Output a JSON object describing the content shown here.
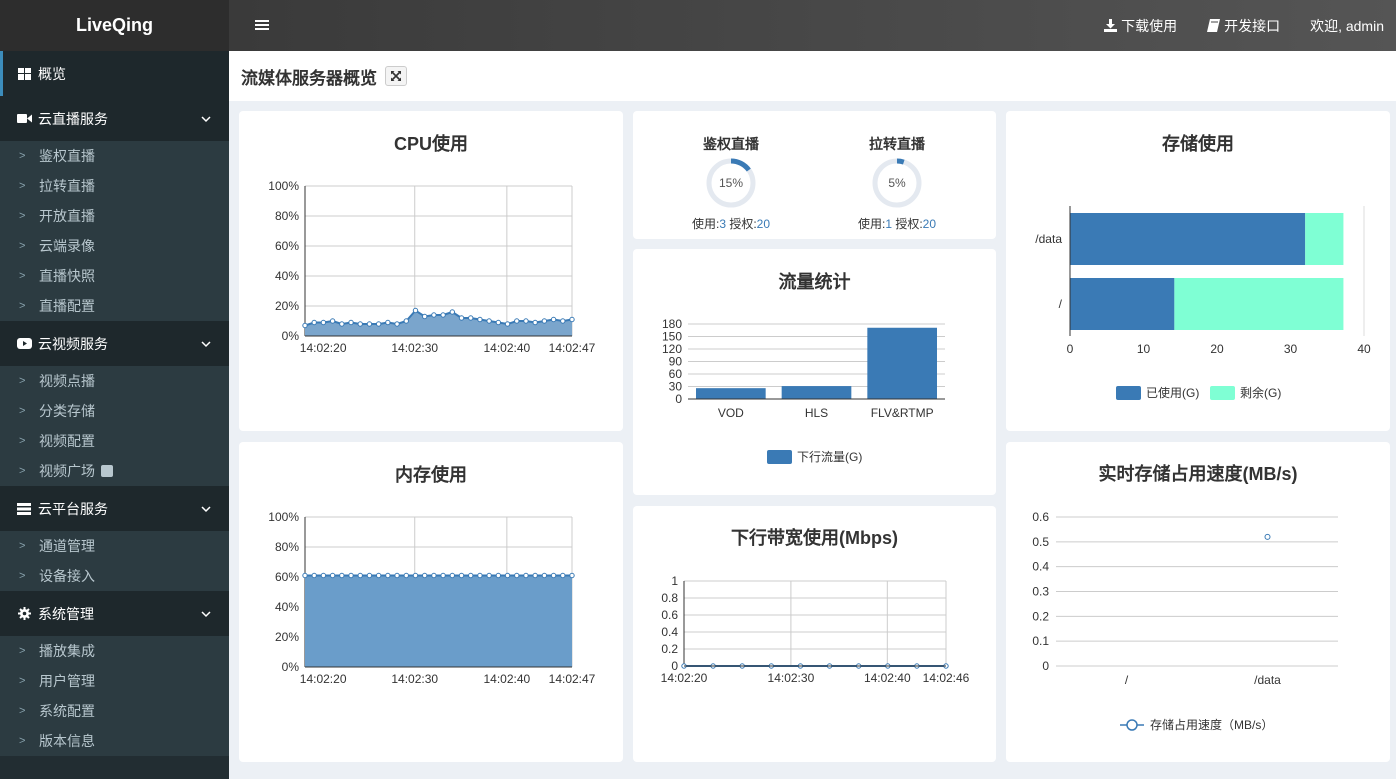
{
  "app": {
    "logo": "LiveQing"
  },
  "header": {
    "download": "下载使用",
    "dev_api": "开发接口",
    "welcome": "欢迎, admin"
  },
  "page": {
    "title": "流媒体服务器概览"
  },
  "sidebar": {
    "overview": "概览",
    "groups": [
      {
        "label": "云直播服务",
        "items": [
          "鉴权直播",
          "拉转直播",
          "开放直播",
          "云端录像",
          "直播快照",
          "直播配置"
        ]
      },
      {
        "label": "云视频服务",
        "items": [
          "视频点播",
          "分类存储",
          "视频配置",
          "视频广场"
        ]
      },
      {
        "label": "云平台服务",
        "items": [
          "通道管理",
          "设备接入"
        ]
      },
      {
        "label": "系统管理",
        "items": [
          "播放集成",
          "用户管理",
          "系统配置",
          "版本信息"
        ]
      }
    ]
  },
  "cpu": {
    "title": "CPU使用",
    "chart_data": {
      "type": "area",
      "title": "CPU使用",
      "x_ticks": [
        "14:02:20",
        "14:02:30",
        "14:02:40",
        "14:02:47"
      ],
      "y_ticks": [
        "100%",
        "80%",
        "60%",
        "40%",
        "20%",
        "0%"
      ],
      "ylim": [
        0,
        100
      ],
      "values": [
        7,
        9,
        9,
        10,
        8,
        9,
        8,
        8,
        8,
        9,
        8,
        10,
        17,
        13,
        14,
        14,
        16,
        12,
        12,
        11,
        10,
        9,
        8,
        10,
        10,
        9,
        10,
        11,
        10,
        11
      ],
      "grid": true,
      "color": "#3a7ab5"
    }
  },
  "memory": {
    "title": "内存使用",
    "chart_data": {
      "type": "area",
      "title": "内存使用",
      "x_ticks": [
        "14:02:20",
        "14:02:30",
        "14:02:40",
        "14:02:47"
      ],
      "y_ticks": [
        "100%",
        "80%",
        "60%",
        "40%",
        "20%",
        "0%"
      ],
      "ylim": [
        0,
        100
      ],
      "values": [
        61,
        61,
        61,
        61,
        61,
        61,
        61,
        61,
        61,
        61,
        61,
        61,
        61,
        61,
        61,
        61,
        61,
        61,
        61,
        61,
        61,
        61,
        61,
        61,
        61,
        61,
        61,
        61,
        61,
        61
      ],
      "grid": true,
      "color": "#3a7ab5"
    }
  },
  "gauges": [
    {
      "title": "鉴权直播",
      "percent": 15,
      "percent_label": "15%",
      "used_label": "使用:",
      "used": "3",
      "auth_label": "授权:",
      "auth": "20"
    },
    {
      "title": "拉转直播",
      "percent": 5,
      "percent_label": "5%",
      "used_label": "使用:",
      "used": "1",
      "auth_label": "授权:",
      "auth": "20"
    }
  ],
  "traffic": {
    "title": "流量统计",
    "chart_data": {
      "type": "bar",
      "title": "流量统计",
      "categories": [
        "VOD",
        "HLS",
        "FLV&RTMP"
      ],
      "series": [
        {
          "name": "下行流量(G)",
          "values": [
            26,
            31,
            171
          ]
        }
      ],
      "y_ticks": [
        "180",
        "150",
        "120",
        "90",
        "60",
        "30",
        "0"
      ],
      "ylim": [
        0,
        180
      ],
      "grid": true,
      "legend": "bottom",
      "color": "#3a7ab5"
    }
  },
  "bandwidth": {
    "title": "下行带宽使用(Mbps)",
    "chart_data": {
      "type": "line",
      "title": "下行带宽使用(Mbps)",
      "x_ticks": [
        "14:02:20",
        "14:02:30",
        "14:02:40",
        "14:02:46"
      ],
      "y_ticks": [
        "1",
        "0.8",
        "0.6",
        "0.4",
        "0.2",
        "0"
      ],
      "ylim": [
        0,
        1
      ],
      "values": [
        0,
        0,
        0,
        0,
        0,
        0,
        0,
        0,
        0,
        0
      ],
      "grid": true,
      "color": "#3a7ab5"
    }
  },
  "storage": {
    "title": "存储使用",
    "chart_data": {
      "type": "bar",
      "orientation": "horizontal",
      "stacked": true,
      "title": "存储使用",
      "categories": [
        "/data",
        "/"
      ],
      "series": [
        {
          "name": "已使用(G)",
          "values": [
            32,
            14.2
          ],
          "color": "#3a7ab5"
        },
        {
          "name": "剩余(G)",
          "values": [
            5.2,
            23
          ],
          "color": "#7fffd4"
        }
      ],
      "x_ticks": [
        "0",
        "10",
        "20",
        "30",
        "40"
      ],
      "xlim": [
        0,
        40
      ],
      "legend": "bottom"
    }
  },
  "speed": {
    "title": "实时存储占用速度(MB/s)",
    "chart_data": {
      "type": "scatter",
      "title": "实时存储占用速度(MB/s)",
      "categories": [
        "/",
        "/data"
      ],
      "series": [
        {
          "name": "存储占用速度（MB/s）",
          "values": [
            0,
            0.52
          ]
        }
      ],
      "y_ticks": [
        "0.6",
        "0.5",
        "0.4",
        "0.3",
        "0.2",
        "0.1",
        "0"
      ],
      "ylim": [
        0,
        0.6
      ],
      "grid": true,
      "legend": "bottom",
      "color": "#3a7ab5"
    }
  }
}
